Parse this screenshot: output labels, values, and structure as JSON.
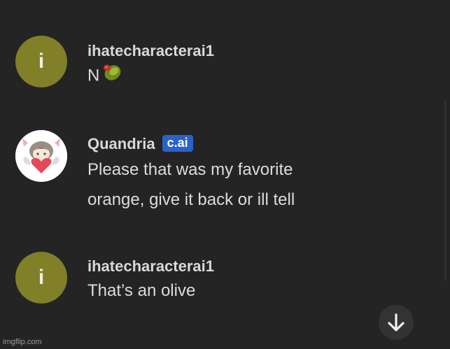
{
  "messages": [
    {
      "avatar_letter": "i",
      "username": "ihatecharacterai1",
      "text": "N"
    },
    {
      "username": "Quandria",
      "badge": "c.ai",
      "lines": [
        "Please that was my favorite",
        "orange, give it back or ill tell"
      ]
    },
    {
      "avatar_letter": "i",
      "username": "ihatecharacterai1",
      "text": "That’s an olive"
    }
  ],
  "scroll_down_icon": "arrow-down-icon",
  "watermark": "imgflip.com",
  "colors": {
    "background": "#242424",
    "avatar_user": "#818029",
    "badge": "#2a62c9"
  }
}
